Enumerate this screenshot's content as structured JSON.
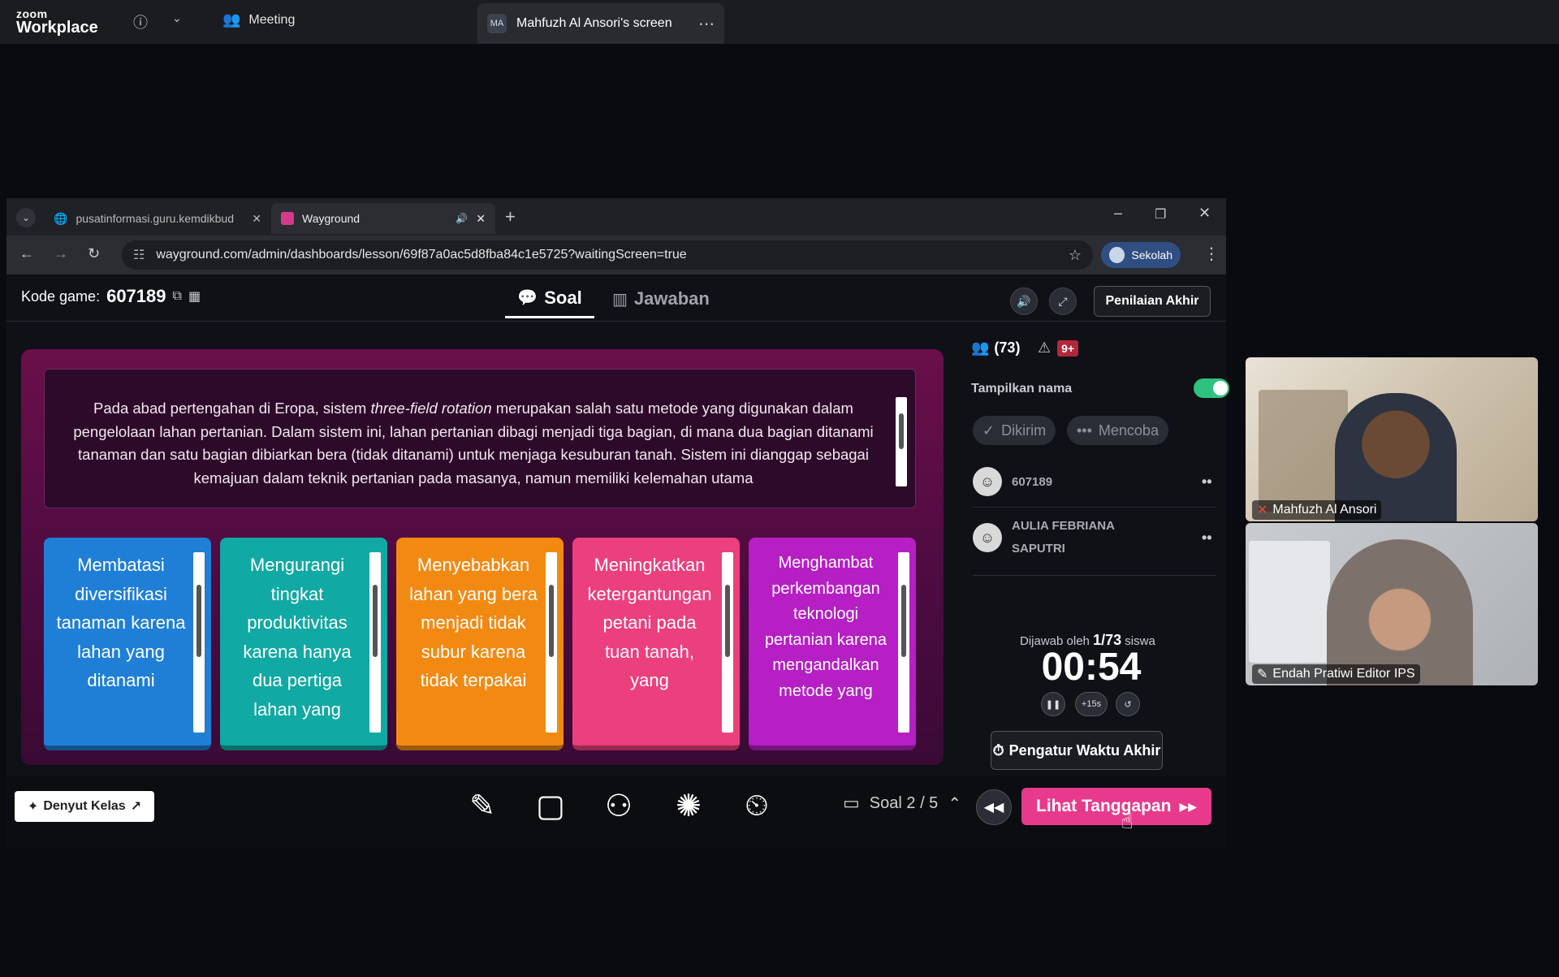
{
  "zoom": {
    "logo_line1": "zoom",
    "logo_line2": "Workplace",
    "meeting_label": "Meeting",
    "screen_avatar": "MA",
    "screen_label": "Mahfuzh Al Ansori's screen"
  },
  "browser": {
    "tabs": [
      {
        "label": "pusatinformasi.guru.kemdikbud",
        "active": false
      },
      {
        "label": "Wayground",
        "active": true
      }
    ],
    "url": "wayground.com/admin/dashboards/lesson/69f87a0ac5d8fba84c1e5725?waitingScreen=true",
    "profile_label": "Sekolah"
  },
  "header": {
    "kode_label": "Kode game:",
    "kode_value": "607189",
    "tab_soal": "Soal",
    "tab_jawaban": "Jawaban",
    "penilaian_label": "Penilaian Akhir"
  },
  "question": {
    "text": "Pada abad pertengahan di Eropa, sistem three-field rotation merupakan salah satu metode yang digunakan dalam pengelolaan lahan pertanian. Dalam sistem ini, lahan pertanian dibagi menjadi tiga bagian, di mana dua bagian ditanami tanaman dan satu bagian dibiarkan bera (tidak ditanami) untuk menjaga kesuburan tanah. Sistem ini dianggap sebagai kemajuan dalam teknik pertanian pada masanya, namun memiliki kelemahan utama",
    "pre_italic": "Pada abad pertengahan di Eropa, sistem ",
    "italic": "three-field rotation",
    "post_italic": " merupakan salah satu metode yang digunakan dalam pengelolaan lahan pertanian. Dalam sistem ini, lahan pertanian dibagi menjadi tiga bagian, di mana dua bagian ditanami tanaman dan satu bagian dibiarkan bera (tidak ditanami) untuk menjaga kesuburan tanah. Sistem ini dianggap sebagai kemajuan dalam teknik pertanian pada masanya, namun memiliki kelemahan utama"
  },
  "options": [
    {
      "text": "Membatasi diversifikasi tanaman karena lahan yang ditanami",
      "color": "#1f7fd6"
    },
    {
      "text": "Mengurangi tingkat produktivitas karena hanya dua pertiga lahan yang",
      "color": "#11a9a3"
    },
    {
      "text": "Menyebabkan lahan yang bera menjadi tidak subur karena tidak terpakai",
      "color": "#f28a12"
    },
    {
      "text": "Meningkatkan ketergantungan petani pada tuan tanah, yang",
      "color": "#ec3f7d"
    },
    {
      "text": "Menghambat perkembangan teknologi pertanian karena mengandalkan metode yang",
      "color": "#b51fc4"
    }
  ],
  "panel": {
    "participants": "(73)",
    "alerts": "9+",
    "tampilkan_nama": "Tampilkan nama",
    "toggle_on": true,
    "filter_dikirim": "Dikirim",
    "filter_mencoba": "Mencoba",
    "players": [
      {
        "name": "607189"
      },
      {
        "name": "AULIA FEBRIANA SAPUTRI"
      }
    ],
    "dijawab_prefix": "Dijawab oleh",
    "dijawab_count": "1/73",
    "dijawab_suffix": "siswa",
    "timer": "00:54",
    "plus15": "+15s",
    "pengatur_label": "Pengatur Waktu Akhir"
  },
  "bottom": {
    "denyut_label": "Denyut Kelas",
    "soal_label": "Soal 2 / 5",
    "lihat_label": "Lihat Tanggapan"
  },
  "videos": [
    {
      "name": "Mahfuzh Al Ansori"
    },
    {
      "name": "Endah Pratiwi Editor IPS"
    }
  ],
  "colors": {
    "accent_pink": "#e83a8c",
    "toggle_green": "#2ec27e"
  }
}
